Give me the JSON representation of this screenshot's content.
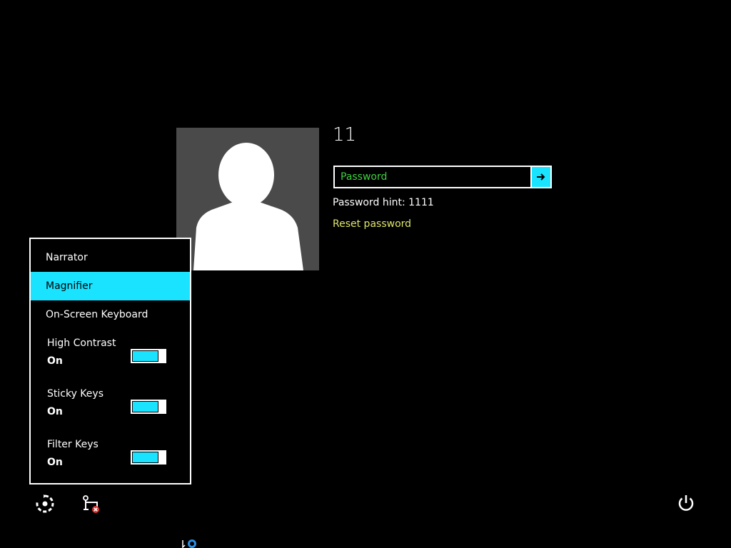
{
  "user": {
    "name": "11",
    "avatar": "default-user-silhouette"
  },
  "password": {
    "placeholder": "Password",
    "value": "",
    "submit_icon": "arrow-right-icon",
    "hint": "Password hint: 1111",
    "reset_link": "Reset password"
  },
  "ease_menu": {
    "items": [
      {
        "label": "Narrator",
        "selected": false
      },
      {
        "label": "Magnifier",
        "selected": true
      },
      {
        "label": "On-Screen Keyboard",
        "selected": false
      }
    ],
    "toggles": [
      {
        "label": "High Contrast",
        "state": "On",
        "on": true
      },
      {
        "label": "Sticky Keys",
        "state": "On",
        "on": true
      },
      {
        "label": "Filter Keys",
        "state": "On",
        "on": true
      }
    ]
  },
  "bottom_bar": {
    "ease_of_access_icon": "ease-of-access-icon",
    "network_icon": "network-disconnected-icon",
    "power_icon": "power-icon"
  },
  "colors": {
    "background": "#000000",
    "accent": "#1ae3ff",
    "placeholder": "#3fd13f",
    "link": "#dfe56a",
    "avatar_bg": "#4a4a4a"
  }
}
